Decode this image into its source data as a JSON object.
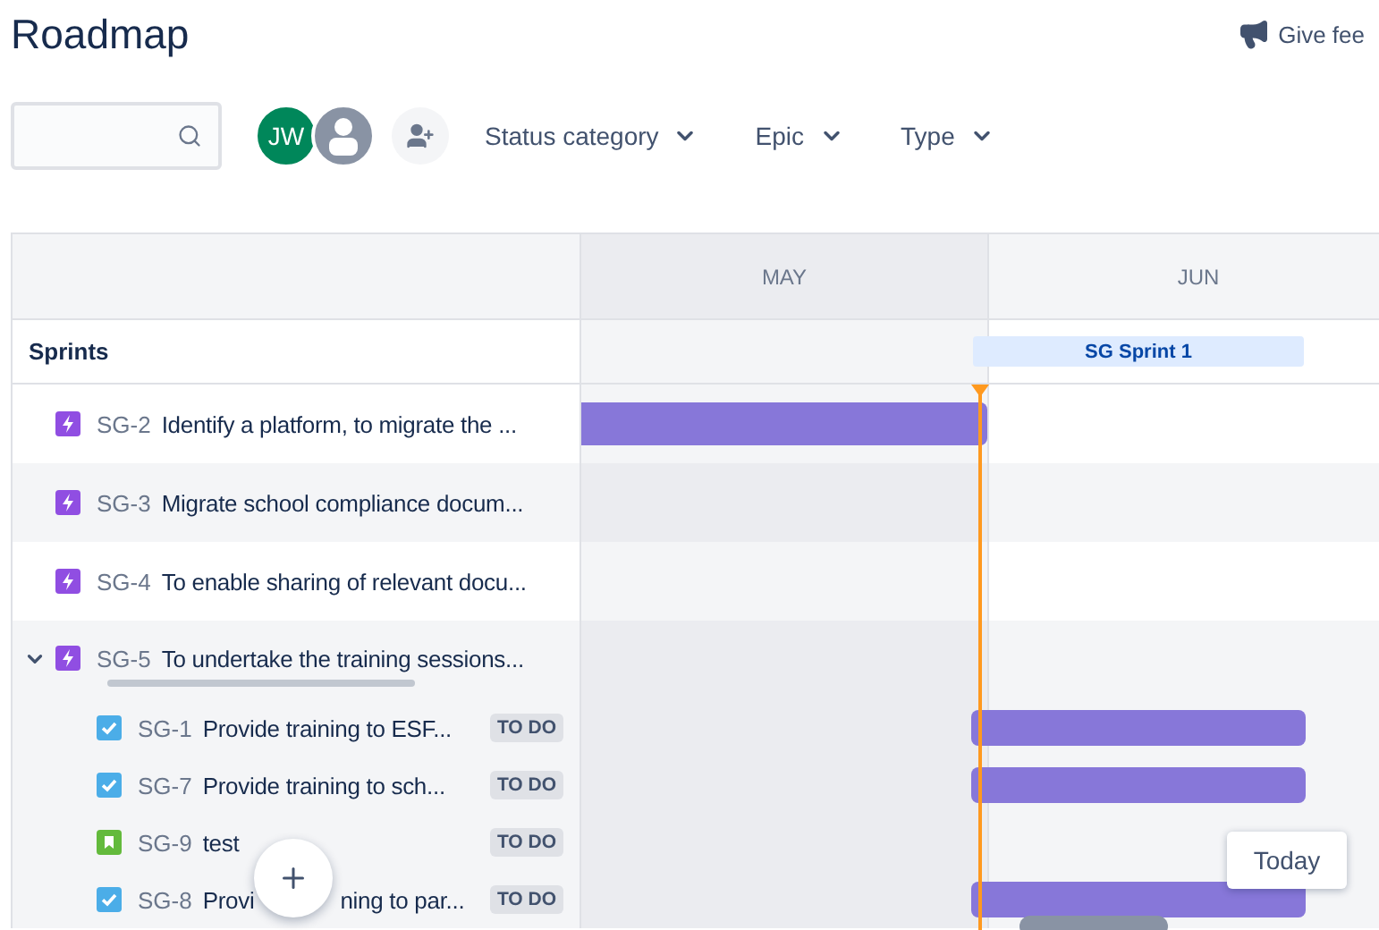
{
  "page": {
    "title": "Roadmap",
    "feedback": "Give fee"
  },
  "toolbar": {
    "avatars": [
      {
        "kind": "initials",
        "initials": "JW"
      },
      {
        "kind": "user"
      }
    ],
    "filters": [
      "Status category",
      "Epic",
      "Type"
    ]
  },
  "timeline": {
    "heading": "Sprints",
    "months": [
      {
        "label": "MAY",
        "past": true
      },
      {
        "label": "JUN",
        "past": false
      }
    ],
    "sprint": "SG Sprint 1"
  },
  "issues": [
    {
      "kind": "epic",
      "key": "SG-2",
      "title": "Identify a platform, to migrate the ...",
      "scheduled": true
    },
    {
      "kind": "epic",
      "key": "SG-3",
      "title": "Migrate school compliance docum..."
    },
    {
      "kind": "epic",
      "key": "SG-4",
      "title": "To enable sharing of relevant docu..."
    },
    {
      "kind": "epic",
      "key": "SG-5",
      "title": "To undertake the training sessions...",
      "expanded": true,
      "progress": {
        "level": 0
      },
      "children": [
        {
          "kind": "task",
          "key": "SG-1",
          "title": "Provide training to ESF...",
          "status": "TO DO",
          "scheduled": true
        },
        {
          "kind": "task",
          "key": "SG-7",
          "title": "Provide training to sch...",
          "status": "TO DO",
          "scheduled": true
        },
        {
          "kind": "story",
          "key": "SG-9",
          "title": "test",
          "status": "TO DO"
        },
        {
          "kind": "task",
          "key": "SG-8",
          "title": "Provi",
          "title_after_button": "ning to par...",
          "status": "TO DO",
          "scheduled": true
        }
      ]
    }
  ],
  "today_button": "Today"
}
